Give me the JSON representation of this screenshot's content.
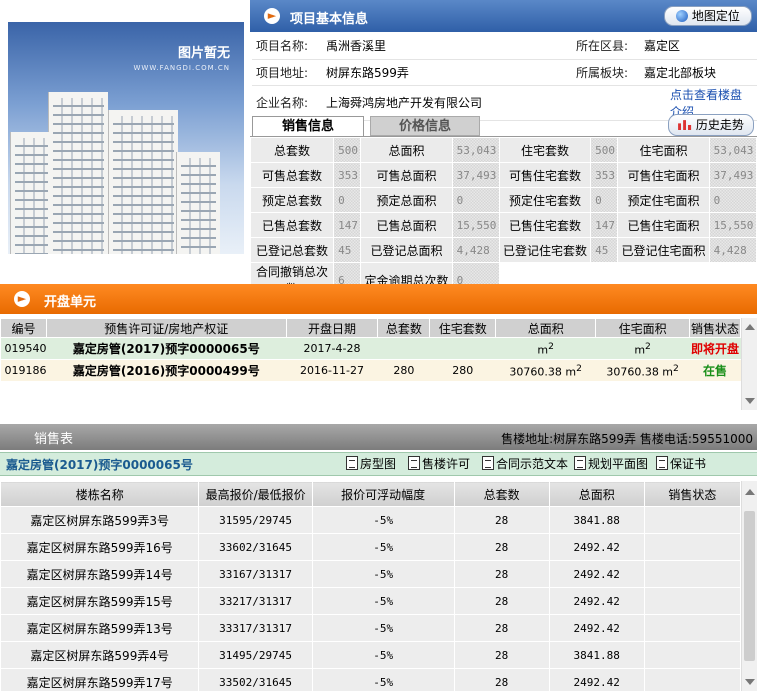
{
  "photo": {
    "caption": "图片暂无",
    "site": "WWW.FANGDI.COM.CN"
  },
  "project": {
    "title": "项目基本信息",
    "map_button": "地图定位",
    "rows": [
      {
        "l1": "项目名称:",
        "v1": "禹洲香溪里",
        "l2": "所在区县:",
        "v2": "嘉定区"
      },
      {
        "l1": "项目地址:",
        "v1": "树屏东路599弄",
        "l2": "所属板块:",
        "v2": "嘉定北部板块"
      },
      {
        "l1": "企业名称:",
        "v1": "上海舜鸿房地产开发有限公司",
        "l2": "",
        "v2": "点击查看楼盘介绍"
      }
    ]
  },
  "tabs": {
    "sales": "销售信息",
    "price": "价格信息",
    "history": "历史走势"
  },
  "sales_grid": [
    [
      {
        "l": "总套数",
        "v": "500"
      },
      {
        "l": "总面积",
        "v": "53,043"
      },
      {
        "l": "住宅套数",
        "v": "500"
      },
      {
        "l": "住宅面积",
        "v": "53,043"
      }
    ],
    [
      {
        "l": "可售总套数",
        "v": "353"
      },
      {
        "l": "可售总面积",
        "v": "37,493"
      },
      {
        "l": "可售住宅套数",
        "v": "353"
      },
      {
        "l": "可售住宅面积",
        "v": "37,493"
      }
    ],
    [
      {
        "l": "预定总套数",
        "v": "0"
      },
      {
        "l": "预定总面积",
        "v": "0"
      },
      {
        "l": "预定住宅套数",
        "v": "0"
      },
      {
        "l": "预定住宅面积",
        "v": "0"
      }
    ],
    [
      {
        "l": "已售总套数",
        "v": "147"
      },
      {
        "l": "已售总面积",
        "v": "15,550"
      },
      {
        "l": "已售住宅套数",
        "v": "147"
      },
      {
        "l": "已售住宅面积",
        "v": "15,550"
      }
    ],
    [
      {
        "l": "已登记总套数",
        "v": "45"
      },
      {
        "l": "已登记总面积",
        "v": "4,428"
      },
      {
        "l": "已登记住宅套数",
        "v": "45"
      },
      {
        "l": "已登记住宅面积",
        "v": "4,428"
      }
    ],
    [
      {
        "l": "合同撤销总次数",
        "v": "6"
      },
      {
        "l": "定金逾期总次数",
        "v": "0"
      }
    ]
  ],
  "open_units": {
    "title": "开盘单元",
    "headers": [
      "编号",
      "预售许可证/房地产权证",
      "开盘日期",
      "总套数",
      "住宅套数",
      "总面积",
      "住宅面积",
      "销售状态"
    ],
    "rows": [
      {
        "id": "019540",
        "permit": "嘉定房管(2017)预字0000065号",
        "date": "2017-4-28",
        "total": "",
        "res": "",
        "area": "m",
        "res_area": "m",
        "status": "即将开盘"
      },
      {
        "id": "019186",
        "permit": "嘉定房管(2016)预字0000499号",
        "date": "2016-11-27",
        "total": "280",
        "res": "280",
        "area": "30760.38 m",
        "res_area": "30760.38 m",
        "status": "在售"
      }
    ]
  },
  "sales_table": {
    "title": "销售表",
    "address": "售楼地址:树屏东路599弄",
    "phone": "售楼电话:59551000",
    "permit": "嘉定房管(2017)预字0000065号",
    "docs": [
      "房型图",
      "售楼许可",
      "合同示范文本",
      "规划平面图",
      "保证书"
    ],
    "headers": [
      "楼栋名称",
      "最高报价/最低报价",
      "报价可浮动幅度",
      "总套数",
      "总面积",
      "销售状态"
    ],
    "rows": [
      [
        "嘉定区树屏东路599弄3号",
        "31595/29745",
        "-5%",
        "28",
        "3841.88",
        ""
      ],
      [
        "嘉定区树屏东路599弄16号",
        "33602/31645",
        "-5%",
        "28",
        "2492.42",
        ""
      ],
      [
        "嘉定区树屏东路599弄14号",
        "33167/31317",
        "-5%",
        "28",
        "2492.42",
        ""
      ],
      [
        "嘉定区树屏东路599弄15号",
        "33217/31317",
        "-5%",
        "28",
        "2492.42",
        ""
      ],
      [
        "嘉定区树屏东路599弄13号",
        "33317/31317",
        "-5%",
        "28",
        "2492.42",
        ""
      ],
      [
        "嘉定区树屏东路599弄4号",
        "31495/29745",
        "-5%",
        "28",
        "3841.88",
        ""
      ],
      [
        "嘉定区树屏东路599弄17号",
        "33502/31645",
        "-5%",
        "28",
        "2492.42",
        ""
      ]
    ]
  }
}
